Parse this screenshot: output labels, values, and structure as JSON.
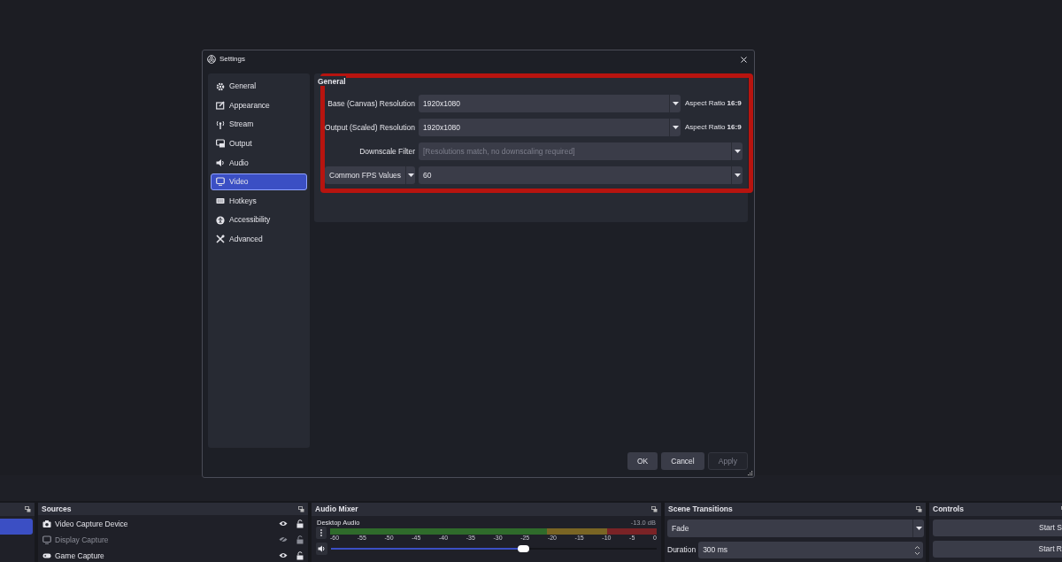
{
  "dialog": {
    "title": "Settings",
    "nav": [
      {
        "label": "General",
        "selected": false
      },
      {
        "label": "Appearance",
        "selected": false
      },
      {
        "label": "Stream",
        "selected": false
      },
      {
        "label": "Output",
        "selected": false
      },
      {
        "label": "Audio",
        "selected": false
      },
      {
        "label": "Video",
        "selected": true
      },
      {
        "label": "Hotkeys",
        "selected": false
      },
      {
        "label": "Accessibility",
        "selected": false
      },
      {
        "label": "Advanced",
        "selected": false
      }
    ],
    "section_title": "General",
    "rows": [
      {
        "kind": "resolution",
        "label": "Base (Canvas) Resolution",
        "value": "1920x1080",
        "aspect": "Aspect Ratio **16:9**"
      },
      {
        "kind": "resolution",
        "label": "Output (Scaled) Resolution",
        "value": "1920x1080",
        "aspect": "Aspect Ratio **16:9**"
      },
      {
        "kind": "filter",
        "label": "Downscale Filter",
        "value": "[Resolutions match, no downscaling required]",
        "disabled": true
      },
      {
        "kind": "fps",
        "label": "Common FPS Values",
        "value": "60"
      }
    ],
    "buttons": [
      {
        "label": "OK",
        "disabled": false
      },
      {
        "label": "Cancel",
        "disabled": false
      },
      {
        "label": "Apply",
        "disabled": true
      }
    ]
  },
  "scenes": [
    {
      "selected": true
    }
  ],
  "sources": {
    "title": "Sources",
    "items": [
      {
        "name": "Video Capture Device",
        "visible": true
      },
      {
        "name": "Display Capture",
        "visible": false
      },
      {
        "name": "Game Capture",
        "visible": true
      }
    ]
  },
  "audio_mixer": {
    "title": "Audio Mixer",
    "channel": "Desktop Audio",
    "reading": "-13.0 dB",
    "ticks": [
      "-60",
      "-55",
      "-50",
      "-45",
      "-40",
      "-35",
      "-30",
      "-25",
      "-20",
      "-15",
      "-10",
      "-5",
      "0"
    ],
    "level": 0.59
  },
  "scene_transitions": {
    "title": "Scene Transitions",
    "transition": "Fade",
    "duration_label": "Duration",
    "duration": "300 ms"
  },
  "controls": {
    "title": "Controls",
    "buttons": [
      "Start S",
      "Start R"
    ]
  }
}
